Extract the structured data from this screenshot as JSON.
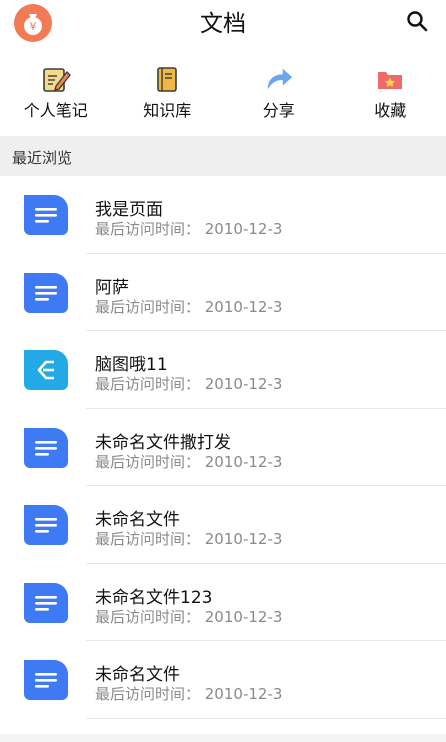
{
  "header": {
    "title": "文档",
    "logo_glyph": "¥"
  },
  "actions": [
    {
      "label": "个人笔记",
      "icon": "note-pencil-icon"
    },
    {
      "label": "知识库",
      "icon": "book-icon"
    },
    {
      "label": "分享",
      "icon": "share-arrow-icon"
    },
    {
      "label": "收藏",
      "icon": "star-folder-icon"
    }
  ],
  "section": {
    "label": "最近浏览"
  },
  "recent": [
    {
      "name": "我是页面",
      "meta": "最后访问时间：  2010-12-3",
      "type": "doc"
    },
    {
      "name": "阿萨",
      "meta": "最后访问时间：  2010-12-3",
      "type": "doc"
    },
    {
      "name": "脑图哦11",
      "meta": "最后访问时间：  2010-12-3",
      "type": "mindmap"
    },
    {
      "name": "未命名文件撒打发",
      "meta": "最后访问时间：  2010-12-3",
      "type": "doc"
    },
    {
      "name": "未命名文件",
      "meta": "最后访问时间：  2010-12-3",
      "type": "doc"
    },
    {
      "name": "未命名文件123",
      "meta": "最后访问时间：  2010-12-3",
      "type": "doc"
    },
    {
      "name": "未命名文件",
      "meta": "最后访问时间：  2010-12-3",
      "type": "doc"
    }
  ],
  "colors": {
    "doc_icon": "#3f7af5",
    "mindmap_icon": "#22a9e6",
    "logo": "#f27a54",
    "favorite": "#f06a6a"
  }
}
